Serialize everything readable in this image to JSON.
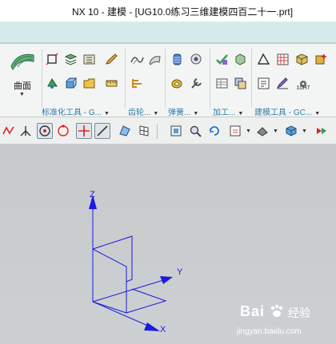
{
  "window": {
    "title": "NX 10 - 建模 - [UG10.0练习三维建模四百二十一.prt]"
  },
  "ribbon": {
    "surface_button_label": "曲面",
    "groups": [
      {
        "label": "标准化工具 - G..."
      },
      {
        "label": "齿轮..."
      },
      {
        "label": "弹簧..."
      },
      {
        "label": "加工..."
      },
      {
        "label": "建模工具 - GC..."
      }
    ],
    "badge_label": "10H7"
  },
  "viewport": {
    "axes": {
      "x_label": "X",
      "y_label": "Y",
      "z_label": "Z"
    },
    "axis_color": "#1a1ae0"
  },
  "watermark": {
    "brand": "Bai",
    "sub": "经验",
    "url": "jingyan.baidu.com"
  },
  "colors": {
    "title_bg": "#ffffff",
    "tab_strip": "#d4ecea",
    "ribbon_bg": "#f3f4f4",
    "group_label": "#2e7da8",
    "viewport_bg": "#c9cbcd"
  }
}
